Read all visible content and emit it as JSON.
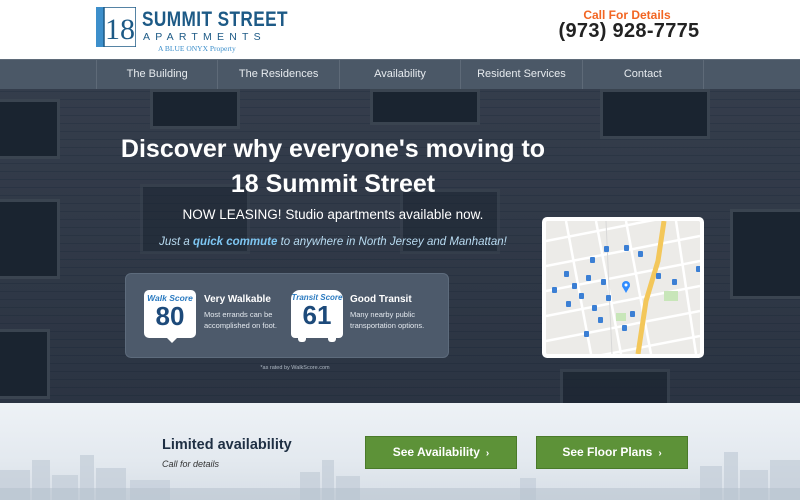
{
  "header": {
    "logo": {
      "mark_text": "18",
      "title": "SUMMIT STREET",
      "subtitle": "APARTMENTS",
      "tagline": "A BLUE ONYX Property"
    },
    "call_label": "Call For Details",
    "phone": "(973) 928-7775"
  },
  "nav": {
    "items": [
      {
        "label": "The Building"
      },
      {
        "label": "The Residences"
      },
      {
        "label": "Availability"
      },
      {
        "label": "Resident Services"
      },
      {
        "label": "Contact"
      }
    ]
  },
  "hero": {
    "headline_line1": "Discover why everyone's moving to",
    "headline_line2": "18 Summit Street",
    "leasing": "NOW LEASING! Studio apartments available now.",
    "commute_pre": "Just a ",
    "commute_bold": "quick commute",
    "commute_post": " to anywhere in North Jersey and Manhattan!",
    "walk": {
      "badge_caption": "Walk Score",
      "score": "80",
      "title": "Very Walkable",
      "description": "Most errands can be accomplished on foot."
    },
    "transit": {
      "badge_caption": "Transit Score",
      "score": "61",
      "title": "Good Transit",
      "description": "Many nearby public transportation options."
    },
    "rated_note": "*as rated by WalkScore.com"
  },
  "bottom": {
    "limited_title": "Limited availability",
    "limited_sub": "Call for details",
    "see_availability": "See Availability",
    "see_floor_plans": "See Floor Plans",
    "chevron_icon": "chevron-right-icon"
  },
  "colors": {
    "accent_orange": "#f26522",
    "brand_blue": "#1d5a86",
    "nav_bg": "#4b5867",
    "button_green": "#5d9238"
  }
}
